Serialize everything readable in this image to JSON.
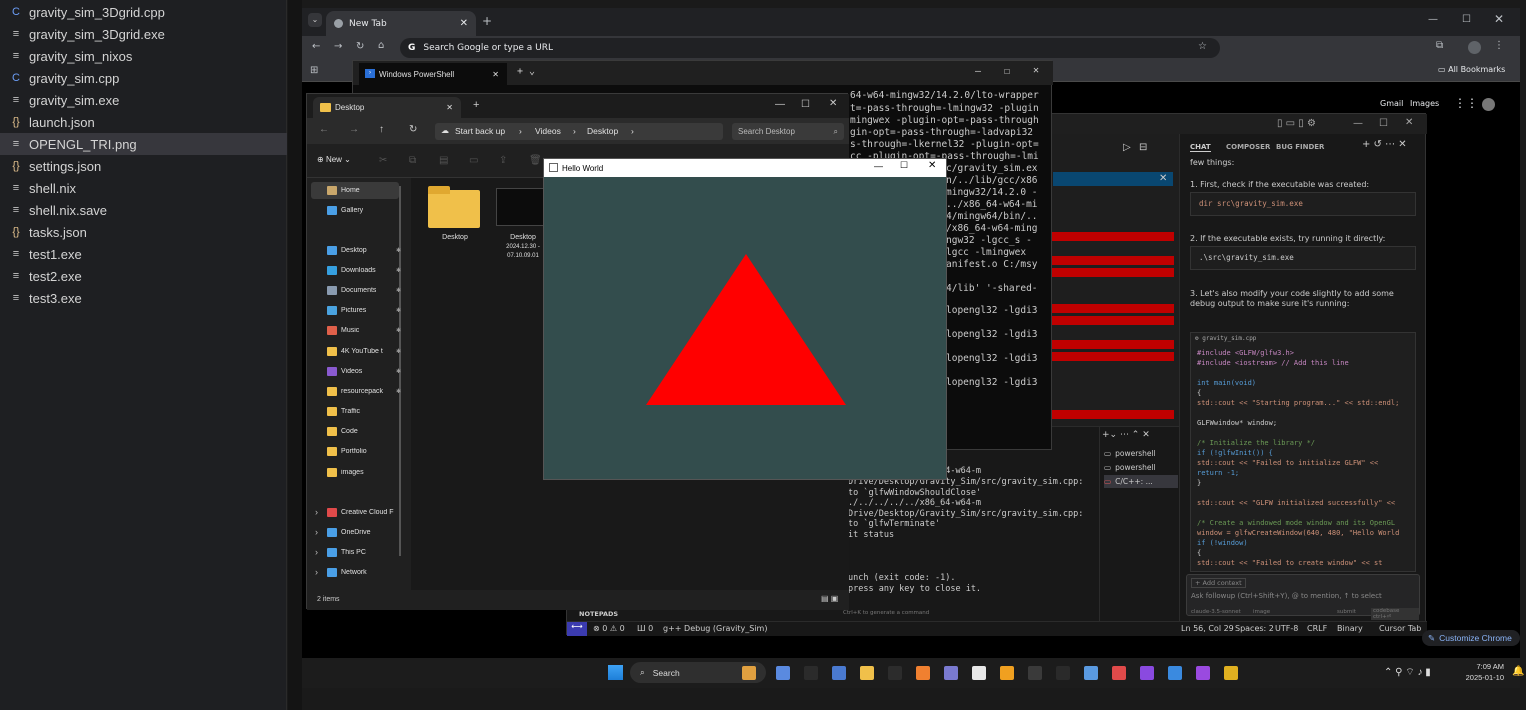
{
  "file_list": {
    "items": [
      {
        "name": "gravity_sim_3Dgrid.cpp",
        "icon": "cpp",
        "selected": false
      },
      {
        "name": "gravity_sim_3Dgrid.exe",
        "icon": "text",
        "selected": false
      },
      {
        "name": "gravity_sim_nixos",
        "icon": "text",
        "selected": false
      },
      {
        "name": "gravity_sim.cpp",
        "icon": "cpp",
        "selected": false
      },
      {
        "name": "gravity_sim.exe",
        "icon": "text",
        "selected": false
      },
      {
        "name": "launch.json",
        "icon": "json",
        "selected": false
      },
      {
        "name": "OPENGL_TRI.png",
        "icon": "text",
        "selected": true
      },
      {
        "name": "settings.json",
        "icon": "json",
        "selected": false
      },
      {
        "name": "shell.nix",
        "icon": "text",
        "selected": false
      },
      {
        "name": "shell.nix.save",
        "icon": "text",
        "selected": false
      },
      {
        "name": "tasks.json",
        "icon": "json",
        "selected": false
      },
      {
        "name": "test1.exe",
        "icon": "text",
        "selected": false
      },
      {
        "name": "test2.exe",
        "icon": "text",
        "selected": false
      },
      {
        "name": "test3.exe",
        "icon": "text",
        "selected": false
      }
    ]
  },
  "chrome": {
    "tab_title": "New Tab",
    "address_placeholder": "Search Google or type a URL",
    "all_bookmarks": "All Bookmarks",
    "gmail": "Gmail",
    "images": "Images",
    "customize": "Customize Chrome"
  },
  "powershell": {
    "tab_title": "Windows PowerShell",
    "lines": [
      "64-w64-mingw32/14.2.0/lto-wrapper",
      "t=-pass-through=-lmingw32 -plugin",
      "mingwex -plugin-opt=-pass-through",
      "gin-opt=-pass-through=-ladvapi32",
      "s-through=-lkernel32 -plugin-opt=",
      "cc -plugin-opt=-pass-through=-lmi",
      "c/gravity_sim.ex",
      "n/../lib/gcc/x86",
      "mingw32/14.2.0 -",
      "../x86_64-w64-mi",
      "4/mingw64/bin/..",
      "/x86_64-w64-ming",
      "ngw32 -lgcc_s -",
      "lgcc -lmingwex",
      "anifest.o C:/msy",
      "4/lib' '-shared-",
      "lopengl32 -lgdi3",
      "lopengl32 -lgdi3",
      "lopengl32 -lgdi3",
      "lopengl32 -lgdi3"
    ]
  },
  "vscode_terminal": {
    "lines": [
      "./../../../../x86_64-w64-m",
      "Drive/Desktop/Gravity_Sim/src/gravity_sim.cpp:",
      " to `glfwWindowShouldClose'",
      "./../../../../x86_64-w64-m",
      "Drive/Desktop/Gravity_Sim/src/gravity_sim.cpp:",
      " to `glfwTerminate'",
      "it status",
      "unch (exit code: -1).",
      " press any key to close it."
    ],
    "shells": [
      "powershell",
      "powershell",
      "C/C++: ..."
    ],
    "notepads": "NOTEPADS",
    "hint": "Ctrl+K to generate a command"
  },
  "vscode_status": {
    "errors": "⊗ 0 ⚠ 0",
    "ports": "Ш 0",
    "debug": "g++ Debug (Gravity_Sim)",
    "position": "Ln 56, Col 29",
    "spaces": "Spaces: 2",
    "encoding": "UTF-8",
    "eol": "CRLF",
    "mode": "Binary",
    "cursor_tab": "Cursor Tab"
  },
  "chat": {
    "tabs": [
      "CHAT",
      "COMPOSER",
      "BUG FINDER"
    ],
    "intro": "few things:",
    "step1": "1. First, check if the executable was created:",
    "code1": "dir src\\gravity_sim.exe",
    "step2": "2. If the executable exists, try running it directly:",
    "code2": ".\\src\\gravity_sim.exe",
    "step3": "3. Let's also modify your code slightly to add some debug output to make sure it's running:",
    "code_file": "gravity_sim.cpp",
    "code_lines": [
      "#include <GLFW/glfw3.h>",
      "#include <iostream>  // Add this line",
      "",
      "int main(void)",
      "{",
      "    std::cout << \"Starting program...\" << std::endl;",
      "",
      "    GLFWwindow* window;",
      "",
      "    /* Initialize the library */",
      "    if (!glfwInit()) {",
      "        std::cout << \"Failed to initialize GLFW\" <<",
      "        return -1;",
      "    }",
      "",
      "    std::cout << \"GLFW initialized successfully\" <<",
      "",
      "    /* Create a windowed mode window and its OpenGL",
      "    window = glfwCreateWindow(640, 480, \"Hello World",
      "    if (!window)",
      "    {",
      "        std::cout << \"Failed to create window\" << st"
    ],
    "add_context": "+ Add context",
    "input_placeholder": "Ask followup (Ctrl+Shift+Y), @ to mention, ↑ to select",
    "model": "claude-3.5-sonnet",
    "image": "image",
    "submit": "submit",
    "codebase": "codebase ctrl+⏎"
  },
  "explorer": {
    "tab_title": "Desktop",
    "breadcrumb": [
      "Start back up",
      "Videos",
      "Desktop"
    ],
    "search_placeholder": "Search Desktop",
    "new_label": "New",
    "sidebar": [
      {
        "label": "Home",
        "color": "#c9a76b",
        "pinned": false
      },
      {
        "label": "Gallery",
        "color": "#4a9fe6",
        "pinned": false
      },
      {
        "label": "Desktop",
        "color": "#4a9fe6",
        "pinned": true
      },
      {
        "label": "Downloads",
        "color": "#36a0e0",
        "pinned": true
      },
      {
        "label": "Documents",
        "color": "#8a9bb0",
        "pinned": true
      },
      {
        "label": "Pictures",
        "color": "#4aa3e0",
        "pinned": true
      },
      {
        "label": "Music",
        "color": "#e0604a",
        "pinned": true
      },
      {
        "label": "4K YouTube t",
        "color": "#f0c04a",
        "pinned": true
      },
      {
        "label": "Videos",
        "color": "#8a5ad0",
        "pinned": true
      },
      {
        "label": "resourcepack",
        "color": "#f0c04a",
        "pinned": true
      },
      {
        "label": "Traffic",
        "color": "#f0c04a",
        "pinned": false
      },
      {
        "label": "Code",
        "color": "#f0c04a",
        "pinned": false
      },
      {
        "label": "Portfolio",
        "color": "#f0c04a",
        "pinned": false
      },
      {
        "label": "images",
        "color": "#f0c04a",
        "pinned": false
      },
      {
        "label": "Creative Cloud F",
        "color": "#e04a4a",
        "pinned": false
      },
      {
        "label": "OneDrive",
        "color": "#4a9fe6",
        "pinned": false
      },
      {
        "label": "This PC",
        "color": "#4a9fe6",
        "pinned": false
      },
      {
        "label": "Network",
        "color": "#4a9fe6",
        "pinned": false
      }
    ],
    "files": [
      {
        "name": "Desktop",
        "sub": ""
      },
      {
        "name": "Desktop",
        "sub": "2024.12.30 -"
      },
      {
        "name": "",
        "sub": "07.10.09.01"
      }
    ],
    "status": "2 items"
  },
  "hello_world": {
    "title": "Hello World",
    "bg_color": "#334d4d",
    "triangle_color": "#ff0000"
  },
  "taskbar": {
    "search": "Search",
    "time": "7:09 AM",
    "date": "2025-01-10"
  }
}
